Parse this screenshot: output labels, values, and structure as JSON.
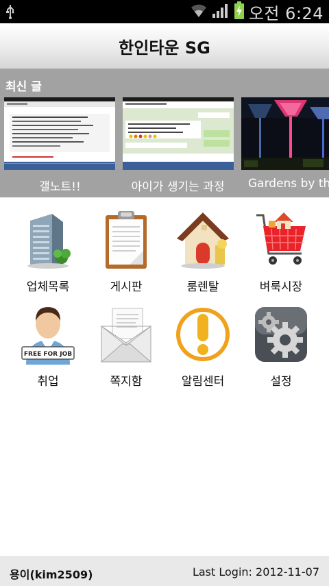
{
  "status": {
    "carrier_time_label": "오전 6:24"
  },
  "title": "한인타운 SG",
  "recent": {
    "header": "최신 글",
    "posts": [
      {
        "caption": "갤노트!!"
      },
      {
        "caption": "아이가 생기는 과정"
      },
      {
        "caption": "Gardens by th"
      }
    ]
  },
  "menu": [
    {
      "label": "업체목록",
      "icon": "building-icon"
    },
    {
      "label": "게시판",
      "icon": "clipboard-icon"
    },
    {
      "label": "룸렌탈",
      "icon": "house-icon"
    },
    {
      "label": "벼룩시장",
      "icon": "shopping-cart-icon"
    },
    {
      "label": "취업",
      "icon": "job-seeker-icon"
    },
    {
      "label": "쪽지함",
      "icon": "envelope-icon"
    },
    {
      "label": "알림센터",
      "icon": "alert-icon"
    },
    {
      "label": "설정",
      "icon": "gear-icon"
    }
  ],
  "job_sign_text": "FREE FOR JOB",
  "footer": {
    "user": "용이(kim2509)",
    "last_login": "Last Login: 2012-11-07"
  }
}
